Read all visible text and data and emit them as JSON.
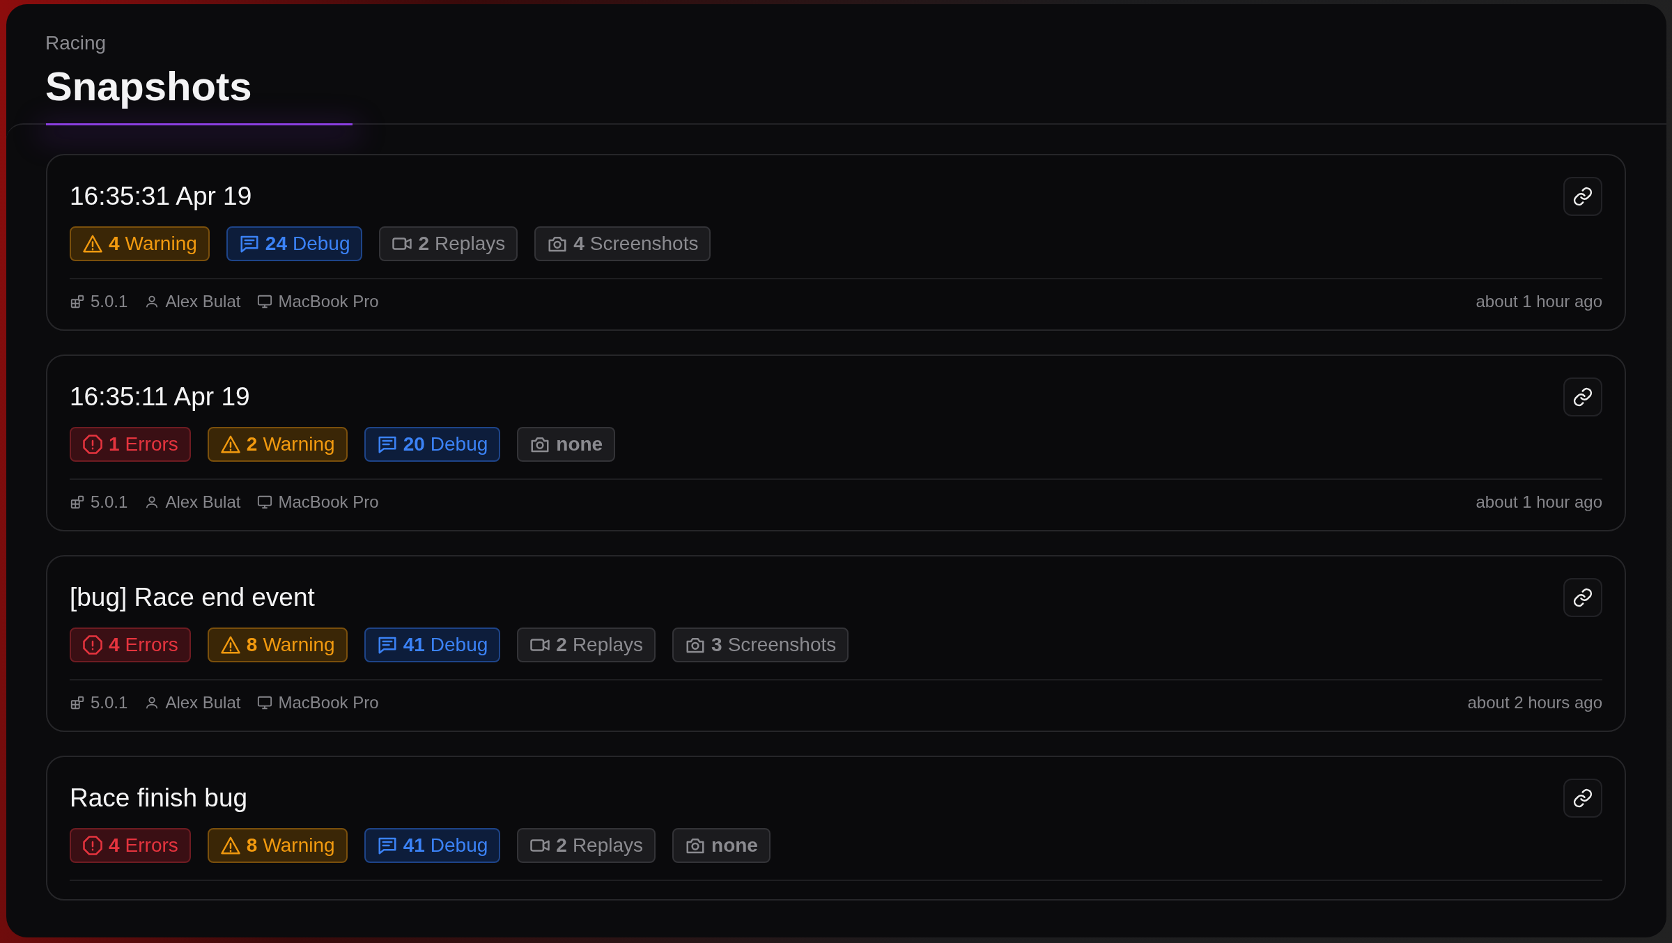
{
  "breadcrumb": "Racing",
  "title": "Snapshots",
  "snapshots": [
    {
      "title": "16:35:31 Apr 19",
      "badges": [
        {
          "kind": "warning",
          "count": "4",
          "label": "Warning"
        },
        {
          "kind": "debug",
          "count": "24",
          "label": "Debug"
        },
        {
          "kind": "replays",
          "count": "2",
          "label": "Replays"
        },
        {
          "kind": "screenshots",
          "count": "4",
          "label": "Screenshots"
        }
      ],
      "version": "5.0.1",
      "user": "Alex Bulat",
      "device": "MacBook Pro",
      "time": "about 1 hour ago"
    },
    {
      "title": "16:35:11 Apr 19",
      "badges": [
        {
          "kind": "error",
          "count": "1",
          "label": "Errors"
        },
        {
          "kind": "warning",
          "count": "2",
          "label": "Warning"
        },
        {
          "kind": "debug",
          "count": "20",
          "label": "Debug"
        },
        {
          "kind": "screenshots",
          "label": "none"
        }
      ],
      "version": "5.0.1",
      "user": "Alex Bulat",
      "device": "MacBook Pro",
      "time": "about 1 hour ago"
    },
    {
      "title": "[bug] Race end event",
      "badges": [
        {
          "kind": "error",
          "count": "4",
          "label": "Errors"
        },
        {
          "kind": "warning",
          "count": "8",
          "label": "Warning"
        },
        {
          "kind": "debug",
          "count": "41",
          "label": "Debug"
        },
        {
          "kind": "replays",
          "count": "2",
          "label": "Replays"
        },
        {
          "kind": "screenshots",
          "count": "3",
          "label": "Screenshots"
        }
      ],
      "version": "5.0.1",
      "user": "Alex Bulat",
      "device": "MacBook Pro",
      "time": "about 2 hours ago"
    },
    {
      "title": "Race finish bug",
      "badges": [
        {
          "kind": "error",
          "count": "4",
          "label": "Errors"
        },
        {
          "kind": "warning",
          "count": "8",
          "label": "Warning"
        },
        {
          "kind": "debug",
          "count": "41",
          "label": "Debug"
        },
        {
          "kind": "replays",
          "count": "2",
          "label": "Replays"
        },
        {
          "kind": "screenshots",
          "label": "none"
        }
      ]
    }
  ]
}
